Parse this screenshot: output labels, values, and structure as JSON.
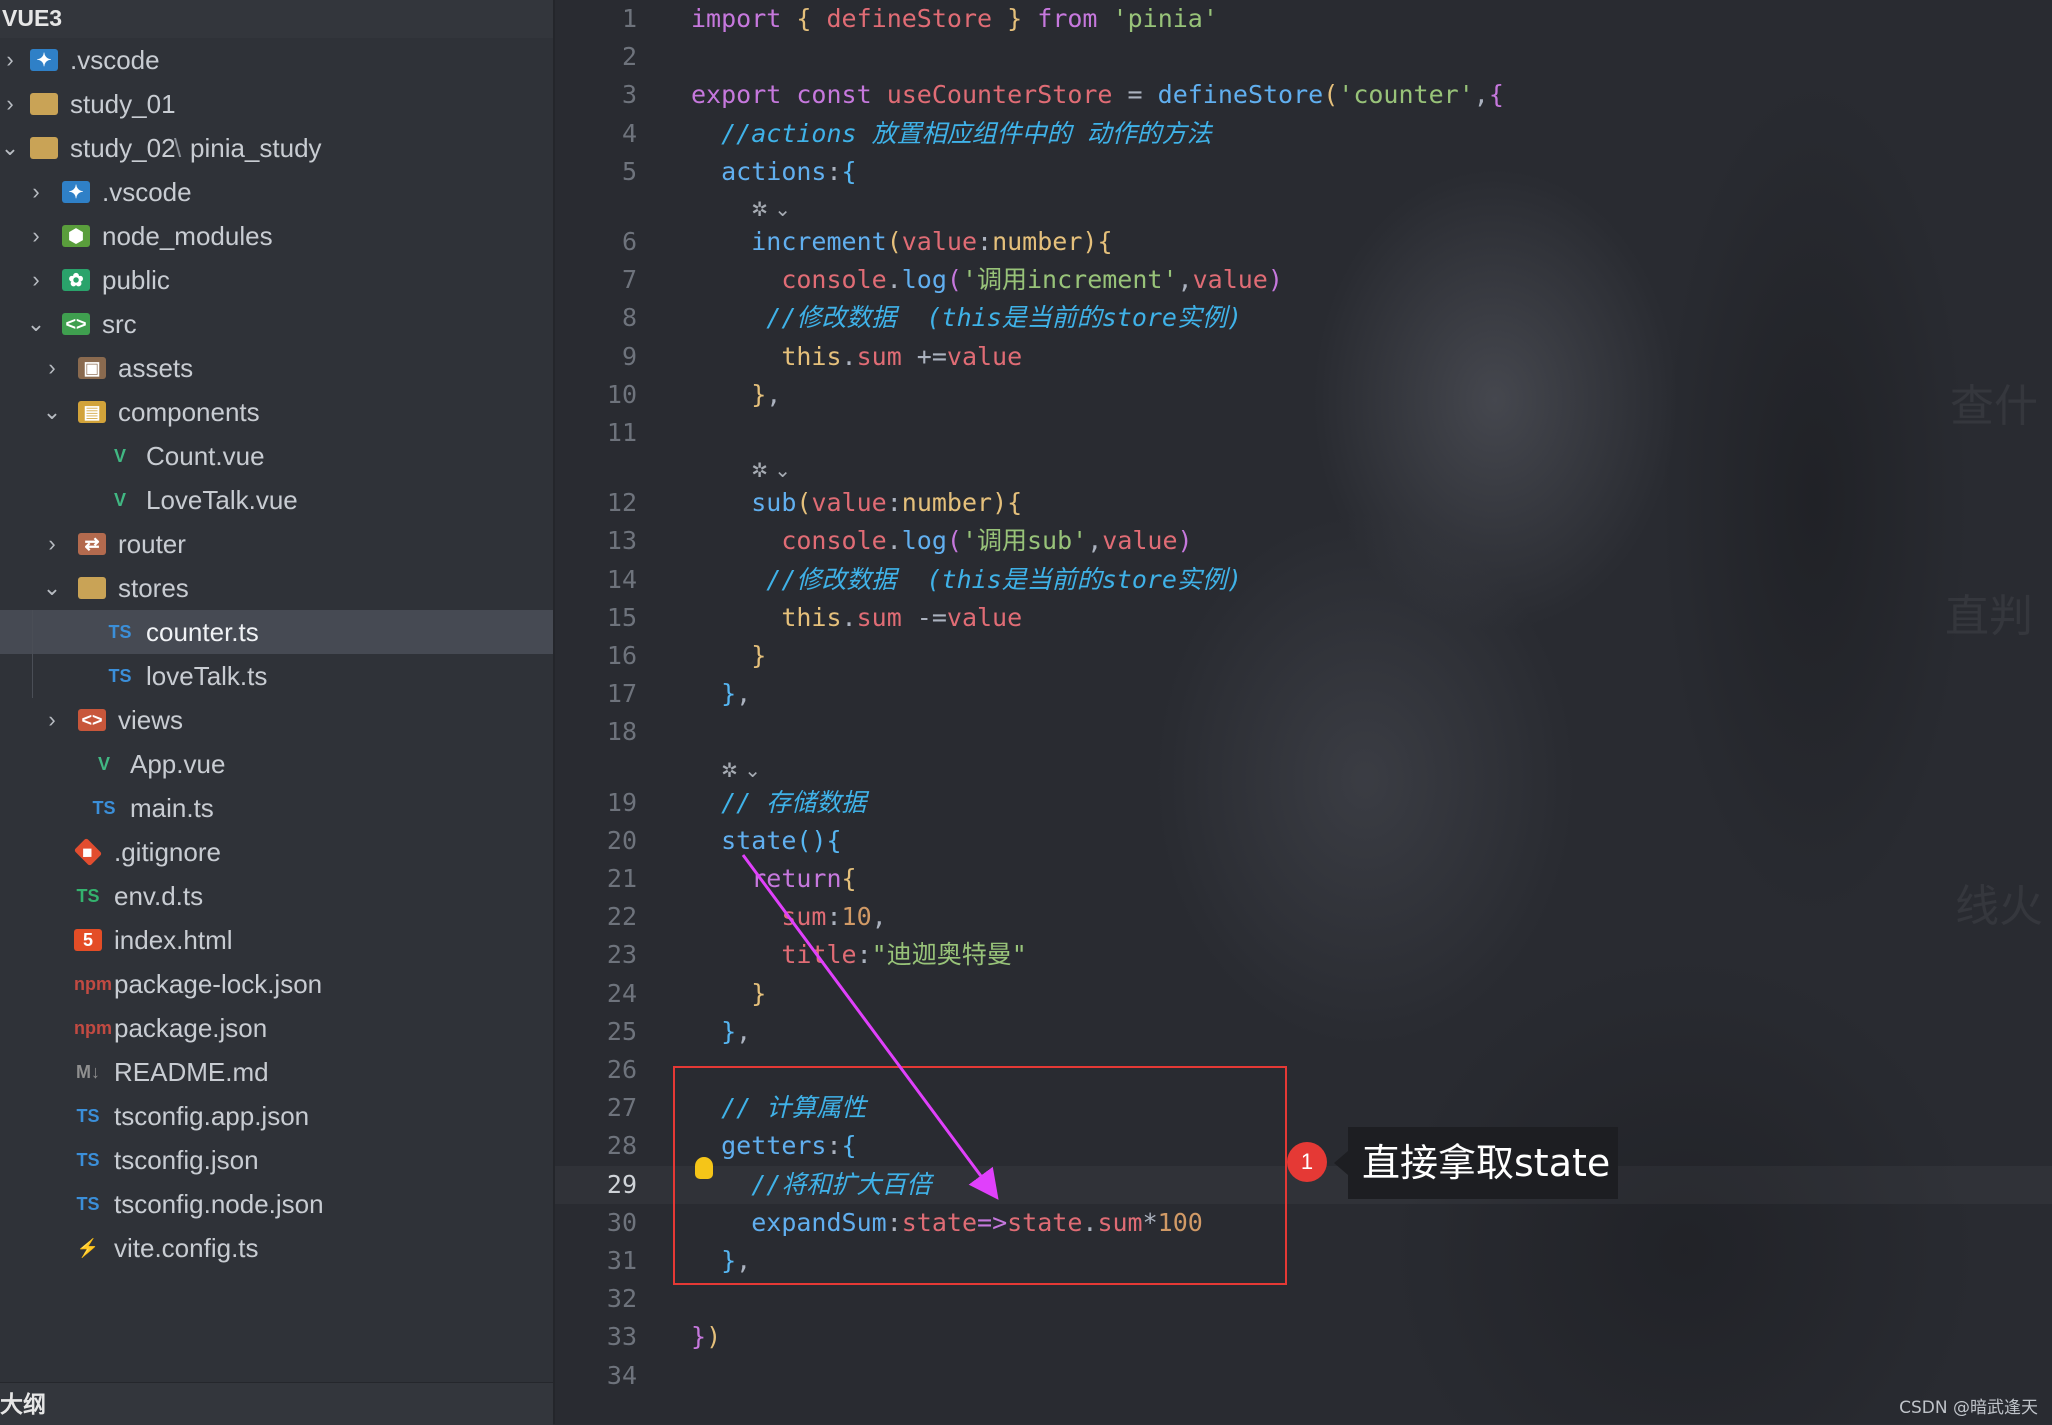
{
  "explorer": {
    "title": "VUE3",
    "outline_label": "大纲",
    "items": [
      {
        "label": ".vscode",
        "chev": "›",
        "icon": "vscode-folder-icon",
        "glyph": "✦"
      },
      {
        "label": "study_01",
        "chev": "›",
        "icon": "folder-icon",
        "glyph": ""
      },
      {
        "label": "study_02",
        "extra": "pinia_study",
        "chev": "⌄",
        "icon": "folder-open-icon",
        "glyph": ""
      },
      {
        "label": ".vscode",
        "chev": "›",
        "icon": "vscode-folder-icon",
        "glyph": "✦"
      },
      {
        "label": "node_modules",
        "chev": "›",
        "icon": "node-folder-icon",
        "glyph": "⬢"
      },
      {
        "label": "public",
        "chev": "›",
        "icon": "public-folder-icon",
        "glyph": "✿"
      },
      {
        "label": "src",
        "chev": "⌄",
        "icon": "src-folder-icon",
        "glyph": "<>"
      },
      {
        "label": "assets",
        "chev": "›",
        "icon": "assets-folder-icon",
        "glyph": "▣"
      },
      {
        "label": "components",
        "chev": "⌄",
        "icon": "components-folder-icon",
        "glyph": "▤"
      },
      {
        "label": "Count.vue",
        "chev": "",
        "icon": "vue-file-icon",
        "glyph": "V"
      },
      {
        "label": "LoveTalk.vue",
        "chev": "",
        "icon": "vue-file-icon",
        "glyph": "V"
      },
      {
        "label": "router",
        "chev": "›",
        "icon": "router-folder-icon",
        "glyph": "⇄"
      },
      {
        "label": "stores",
        "chev": "⌄",
        "icon": "folder-open-icon",
        "glyph": ""
      },
      {
        "label": "counter.ts",
        "chev": "",
        "icon": "ts-file-icon",
        "glyph": "TS"
      },
      {
        "label": "loveTalk.ts",
        "chev": "",
        "icon": "ts-file-icon",
        "glyph": "TS"
      },
      {
        "label": "views",
        "chev": "›",
        "icon": "views-folder-icon",
        "glyph": "<>"
      },
      {
        "label": "App.vue",
        "chev": "",
        "icon": "vue-file-icon",
        "glyph": "V"
      },
      {
        "label": "main.ts",
        "chev": "",
        "icon": "ts-file-icon",
        "glyph": "TS"
      },
      {
        "label": ".gitignore",
        "chev": "",
        "icon": "git-file-icon",
        "glyph": "◆"
      },
      {
        "label": "env.d.ts",
        "chev": "",
        "icon": "ts-definition-icon",
        "glyph": "TS"
      },
      {
        "label": "index.html",
        "chev": "",
        "icon": "html5-file-icon",
        "glyph": "5"
      },
      {
        "label": "package-lock.json",
        "chev": "",
        "icon": "npm-file-icon",
        "glyph": "npm"
      },
      {
        "label": "package.json",
        "chev": "",
        "icon": "npm-file-icon",
        "glyph": "npm"
      },
      {
        "label": "README.md",
        "chev": "",
        "icon": "markdown-file-icon",
        "glyph": "M↓"
      },
      {
        "label": "tsconfig.app.json",
        "chev": "",
        "icon": "tsconfig-file-icon",
        "glyph": "TS"
      },
      {
        "label": "tsconfig.json",
        "chev": "",
        "icon": "tsconfig-file-icon",
        "glyph": "TS"
      },
      {
        "label": "tsconfig.node.json",
        "chev": "",
        "icon": "tsconfig-file-icon",
        "glyph": "TS"
      },
      {
        "label": "vite.config.ts",
        "chev": "",
        "icon": "vite-file-icon",
        "glyph": "⚡"
      }
    ]
  },
  "editor": {
    "lines": [
      {
        "n": "1",
        "tokens": [
          [
            "kw",
            "import"
          ],
          [
            "pn",
            " "
          ],
          [
            "br1",
            "{"
          ],
          [
            "pn",
            " "
          ],
          [
            "def",
            "defineStore"
          ],
          [
            "pn",
            " "
          ],
          [
            "br1",
            "}"
          ],
          [
            "pn",
            " "
          ],
          [
            "kw",
            "from"
          ],
          [
            "pn",
            " "
          ],
          [
            "str",
            "'pinia'"
          ]
        ]
      },
      {
        "n": "2",
        "tokens": []
      },
      {
        "n": "3",
        "tokens": [
          [
            "kw",
            "export"
          ],
          [
            "pn",
            " "
          ],
          [
            "kw",
            "const"
          ],
          [
            "pn",
            " "
          ],
          [
            "def",
            "useCounterStore"
          ],
          [
            "pn",
            " = "
          ],
          [
            "fn",
            "defineStore"
          ],
          [
            "br1",
            "("
          ],
          [
            "str",
            "'counter'"
          ],
          [
            "pn",
            ","
          ],
          [
            "br2",
            "{"
          ]
        ]
      },
      {
        "n": "4",
        "tokens": [
          [
            "pn",
            "  "
          ],
          [
            "cm",
            "//actions 放置相应组件中的 动作的方法"
          ]
        ]
      },
      {
        "n": "5",
        "tokens": [
          [
            "pn",
            "  "
          ],
          [
            "fn",
            "actions"
          ],
          [
            "pn",
            ":"
          ],
          [
            "br3",
            "{"
          ]
        ]
      },
      {
        "lens": "✲ ⌄",
        "indent": 4
      },
      {
        "n": "6",
        "tokens": [
          [
            "pn",
            "    "
          ],
          [
            "fn",
            "increment"
          ],
          [
            "br1",
            "("
          ],
          [
            "var",
            "value"
          ],
          [
            "pn",
            ":"
          ],
          [
            "type",
            "number"
          ],
          [
            "br1",
            ")"
          ],
          [
            "br1",
            "{"
          ]
        ]
      },
      {
        "n": "7",
        "tokens": [
          [
            "pn",
            "      "
          ],
          [
            "var",
            "console"
          ],
          [
            "pn",
            "."
          ],
          [
            "fn",
            "log"
          ],
          [
            "br2",
            "("
          ],
          [
            "str",
            "'调用increment'"
          ],
          [
            "pn",
            ","
          ],
          [
            "var",
            "value"
          ],
          [
            "br2",
            ")"
          ]
        ]
      },
      {
        "n": "8",
        "tokens": [
          [
            "pn",
            "     "
          ],
          [
            "cm",
            "//修改数据  (this是当前的store实例)"
          ]
        ]
      },
      {
        "n": "9",
        "tokens": [
          [
            "pn",
            "      "
          ],
          [
            "this",
            "this"
          ],
          [
            "pn",
            "."
          ],
          [
            "prop",
            "sum"
          ],
          [
            "pn",
            " +="
          ],
          [
            "var",
            "value"
          ]
        ]
      },
      {
        "n": "10",
        "tokens": [
          [
            "pn",
            "    "
          ],
          [
            "br1",
            "}"
          ],
          [
            "pn",
            ","
          ]
        ]
      },
      {
        "n": "11",
        "tokens": []
      },
      {
        "lens": "✲ ⌄",
        "indent": 4
      },
      {
        "n": "12",
        "tokens": [
          [
            "pn",
            "    "
          ],
          [
            "fn",
            "sub"
          ],
          [
            "br1",
            "("
          ],
          [
            "var",
            "value"
          ],
          [
            "pn",
            ":"
          ],
          [
            "type",
            "number"
          ],
          [
            "br1",
            ")"
          ],
          [
            "br1",
            "{"
          ]
        ]
      },
      {
        "n": "13",
        "tokens": [
          [
            "pn",
            "      "
          ],
          [
            "var",
            "console"
          ],
          [
            "pn",
            "."
          ],
          [
            "fn",
            "log"
          ],
          [
            "br2",
            "("
          ],
          [
            "str",
            "'调用sub'"
          ],
          [
            "pn",
            ","
          ],
          [
            "var",
            "value"
          ],
          [
            "br2",
            ")"
          ]
        ]
      },
      {
        "n": "14",
        "tokens": [
          [
            "pn",
            "     "
          ],
          [
            "cm",
            "//修改数据  (this是当前的store实例)"
          ]
        ]
      },
      {
        "n": "15",
        "tokens": [
          [
            "pn",
            "      "
          ],
          [
            "this",
            "this"
          ],
          [
            "pn",
            "."
          ],
          [
            "prop",
            "sum"
          ],
          [
            "pn",
            " -="
          ],
          [
            "var",
            "value"
          ]
        ]
      },
      {
        "n": "16",
        "tokens": [
          [
            "pn",
            "    "
          ],
          [
            "br1",
            "}"
          ]
        ]
      },
      {
        "n": "17",
        "tokens": [
          [
            "pn",
            "  "
          ],
          [
            "br3",
            "}"
          ],
          [
            "pn",
            ","
          ]
        ]
      },
      {
        "n": "18",
        "tokens": []
      },
      {
        "lens": "✲ ⌄",
        "indent": 2
      },
      {
        "n": "19",
        "tokens": [
          [
            "pn",
            "  "
          ],
          [
            "cm",
            "// 存储数据"
          ]
        ]
      },
      {
        "n": "20",
        "tokens": [
          [
            "pn",
            "  "
          ],
          [
            "fn",
            "state"
          ],
          [
            "br3",
            "("
          ],
          [
            "br3",
            ")"
          ],
          [
            "br3",
            "{"
          ]
        ]
      },
      {
        "n": "21",
        "tokens": [
          [
            "pn",
            "    "
          ],
          [
            "kw",
            "return"
          ],
          [
            "br1",
            "{"
          ]
        ]
      },
      {
        "n": "22",
        "tokens": [
          [
            "pn",
            "      "
          ],
          [
            "var",
            "sum"
          ],
          [
            "pn",
            ":"
          ],
          [
            "num",
            "10"
          ],
          [
            "pn",
            ","
          ]
        ]
      },
      {
        "n": "23",
        "tokens": [
          [
            "pn",
            "      "
          ],
          [
            "var",
            "title"
          ],
          [
            "pn",
            ":"
          ],
          [
            "str",
            "\"迪迦奥特曼\""
          ]
        ]
      },
      {
        "n": "24",
        "tokens": [
          [
            "pn",
            "    "
          ],
          [
            "br1",
            "}"
          ]
        ]
      },
      {
        "n": "25",
        "tokens": [
          [
            "pn",
            "  "
          ],
          [
            "br3",
            "}"
          ],
          [
            "pn",
            ","
          ]
        ]
      },
      {
        "n": "26",
        "tokens": []
      },
      {
        "n": "27",
        "tokens": [
          [
            "pn",
            "  "
          ],
          [
            "cm",
            "// 计算属性"
          ]
        ]
      },
      {
        "n": "28",
        "tokens": [
          [
            "pn",
            "  "
          ],
          [
            "fn",
            "getters"
          ],
          [
            "pn",
            ":"
          ],
          [
            "br3",
            "{"
          ]
        ]
      },
      {
        "n": "29",
        "current": true,
        "tokens": [
          [
            "pn",
            "    "
          ],
          [
            "cm",
            "//将和扩大百倍"
          ]
        ]
      },
      {
        "n": "30",
        "tokens": [
          [
            "pn",
            "    "
          ],
          [
            "fn",
            "expandSum"
          ],
          [
            "pn",
            ":"
          ],
          [
            "var",
            "state"
          ],
          [
            "kw",
            "=>"
          ],
          [
            "var",
            "state"
          ],
          [
            "pn",
            "."
          ],
          [
            "var",
            "sum"
          ],
          [
            "pn",
            "*"
          ],
          [
            "num",
            "100"
          ]
        ]
      },
      {
        "n": "31",
        "tokens": [
          [
            "pn",
            "  "
          ],
          [
            "br3",
            "}"
          ],
          [
            "pn",
            ","
          ]
        ]
      },
      {
        "n": "32",
        "tokens": []
      },
      {
        "n": "33",
        "tokens": [
          [
            "br2",
            "}"
          ],
          [
            "br1",
            ")"
          ]
        ]
      },
      {
        "n": "34",
        "tokens": []
      }
    ]
  },
  "annotation": {
    "badge": "1",
    "text": "直接拿取state",
    "box_color": "#e53935",
    "arrow_color": "#e040fb"
  },
  "watermark": "CSDN @暗武逢天"
}
